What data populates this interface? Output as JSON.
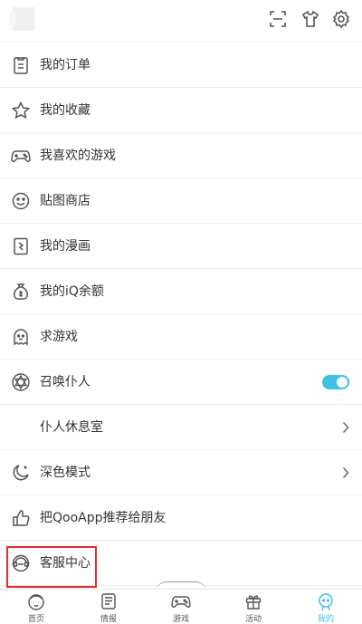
{
  "colors": {
    "accent": "#3ec0e4",
    "highlight": "#e32b2b",
    "text": "#333333",
    "icon": "#555555"
  },
  "header": {
    "icons": [
      "scan-icon",
      "tshirt-icon",
      "gear-icon"
    ]
  },
  "menu": {
    "items": [
      {
        "label": "我的订单",
        "icon": "order-icon"
      },
      {
        "label": "我的收藏",
        "icon": "star-icon"
      },
      {
        "label": "我喜欢的游戏",
        "icon": "gamepad-icon"
      },
      {
        "label": "贴图商店",
        "icon": "sticker-icon"
      },
      {
        "label": "我的漫画",
        "icon": "comic-icon"
      },
      {
        "label": "我的iQ余额",
        "icon": "money-bag-icon"
      },
      {
        "label": "求游戏",
        "icon": "ghost-icon"
      },
      {
        "label": "召唤仆人",
        "icon": "star-of-david-icon",
        "toggle": true
      },
      {
        "label": "仆人休息室",
        "chevron": true
      },
      {
        "label": "深色模式",
        "icon": "moon-icon",
        "chevron": true
      },
      {
        "label": "把QooApp推荐给朋友",
        "icon": "thumbs-up-icon"
      },
      {
        "label": "客服中心",
        "icon": "headset-icon"
      }
    ]
  },
  "tabs": [
    {
      "label": "首页",
      "icon": "home-avatar-icon"
    },
    {
      "label": "情报",
      "icon": "news-icon"
    },
    {
      "label": "游戏",
      "icon": "gamepad-icon"
    },
    {
      "label": "活动",
      "icon": "gift-icon"
    },
    {
      "label": "我的",
      "icon": "profile-icon",
      "active": true
    }
  ]
}
